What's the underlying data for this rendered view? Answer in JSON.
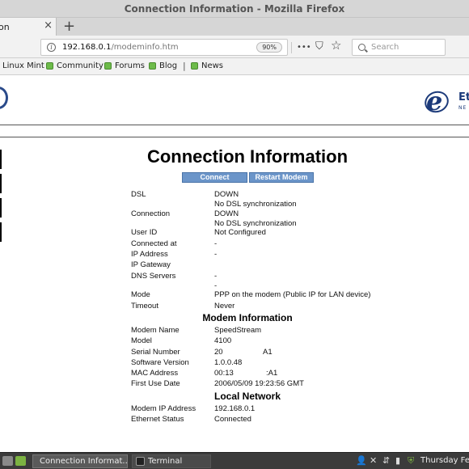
{
  "window": {
    "title": "Connection Information - Mozilla Firefox"
  },
  "tab": {
    "label": "on",
    "close": "×",
    "new_tab": "+"
  },
  "navbar": {
    "url_host": "192.168.0.1",
    "url_path": "/modeminfo.htm",
    "zoom": "90%",
    "more": "•••",
    "pocket": "⛉",
    "star": "☆",
    "search_placeholder": "Search"
  },
  "bookmarks": {
    "items": [
      "Linux Mint",
      "Community",
      "Forums",
      "Blog",
      "News"
    ],
    "separator": "|"
  },
  "logo": {
    "brand": "Et",
    "sub": "NE",
    "letter": "e"
  },
  "page": {
    "title": "Connection Information",
    "buttons": {
      "connect": "Connect",
      "restart": "Restart Modem"
    },
    "connection": [
      {
        "key": "DSL",
        "value": "DOWN",
        "value2": "No DSL synchronization"
      },
      {
        "key": "Connection",
        "value": "DOWN",
        "value2": "No DSL synchronization"
      },
      {
        "key": "User ID",
        "value": "Not Configured"
      },
      {
        "key": "Connected at",
        "value": "-"
      },
      {
        "key": "IP Address",
        "value": "-"
      },
      {
        "key": "IP Gateway",
        "value": ""
      },
      {
        "key": "DNS Servers",
        "value": "-",
        "value2": "-"
      },
      {
        "key": "Mode",
        "value": "PPP on the modem (Public IP for LAN device)"
      },
      {
        "key": "Timeout",
        "value": "Never"
      }
    ],
    "modem_title": "Modem Information",
    "modem": [
      {
        "key": "Modem Name",
        "value": "SpeedStream"
      },
      {
        "key": "Model",
        "value": "4100"
      },
      {
        "key": "Serial Number",
        "value": "20",
        "suffix": "A1"
      },
      {
        "key": "Software Version",
        "value": "1.0.0.48"
      },
      {
        "key": "MAC Address",
        "value": "00:13",
        "suffix": ":A1"
      },
      {
        "key": "First Use Date",
        "value": "2006/05/09 19:23:56 GMT"
      }
    ],
    "local_title": "Local Network",
    "local": [
      {
        "key": "Modem IP Address",
        "value": "192.168.0.1"
      },
      {
        "key": "Ethernet Status",
        "value": "Connected"
      }
    ]
  },
  "taskbar": {
    "tasks": [
      "Connection Informat...",
      "Terminal"
    ],
    "clock": "Thursday Feb"
  },
  "colors": {
    "button_bg": "#6b95c9",
    "logo_blue": "#1c3a7a",
    "taskbar_bg": "#3b3b3b"
  }
}
